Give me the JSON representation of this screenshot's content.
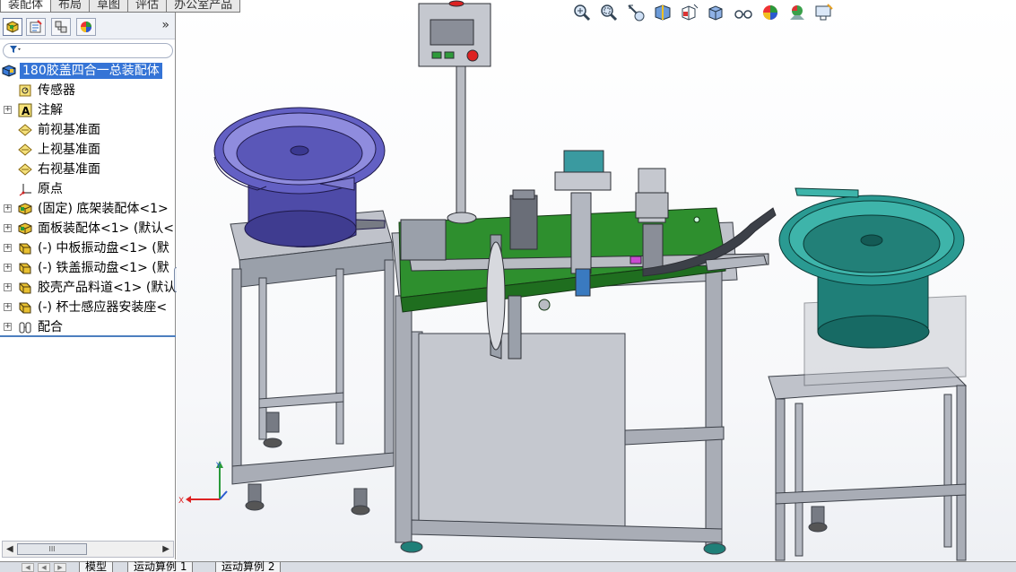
{
  "command_manager_tabs": [
    "装配体",
    "布局",
    "草图",
    "评估",
    "办公室产品"
  ],
  "feature_tree": {
    "expand_arrow": "»",
    "root": {
      "label": "180胶盖四合一总装配体",
      "icon": "assembly-icon"
    },
    "items": [
      {
        "label": "传感器",
        "icon": "sensor-icon",
        "toggle": ""
      },
      {
        "label": "注解",
        "icon": "annotation-icon",
        "toggle": "+"
      },
      {
        "label": "前视基准面",
        "icon": "plane-icon",
        "toggle": ""
      },
      {
        "label": "上视基准面",
        "icon": "plane-icon",
        "toggle": ""
      },
      {
        "label": "右视基准面",
        "icon": "plane-icon",
        "toggle": ""
      },
      {
        "label": "原点",
        "icon": "origin-icon",
        "toggle": ""
      },
      {
        "label": "(固定) 底架装配体<1>",
        "icon": "subassembly-icon",
        "toggle": "+"
      },
      {
        "label": "面板装配体<1> (默认<",
        "icon": "subassembly-icon",
        "toggle": "+"
      },
      {
        "label": "(-) 中板振动盘<1> (默",
        "icon": "subassembly-yellow-icon",
        "toggle": "+"
      },
      {
        "label": "(-) 铁盖振动盘<1> (默",
        "icon": "subassembly-yellow-icon",
        "toggle": "+"
      },
      {
        "label": "胶壳产品料道<1> (默认",
        "icon": "subassembly-yellow-icon",
        "toggle": "+"
      },
      {
        "label": "(-) 杯士感应器安装座<",
        "icon": "subassembly-yellow-icon",
        "toggle": "+"
      },
      {
        "label": "配合",
        "icon": "mates-icon",
        "toggle": "+"
      }
    ]
  },
  "scrollbar": {
    "thumb_label": "III"
  },
  "bottom_tabs": [
    "模型",
    "运动算例 1",
    "运动算例 2"
  ],
  "axis_triad": {
    "x": "X",
    "y": "Y"
  },
  "colors": {
    "selection": "#3574d6",
    "left_bowl": "#5a58b4",
    "right_bowl": "#1f7f78",
    "table_top": "#2e8f2e",
    "frame": "#a9adb6"
  }
}
